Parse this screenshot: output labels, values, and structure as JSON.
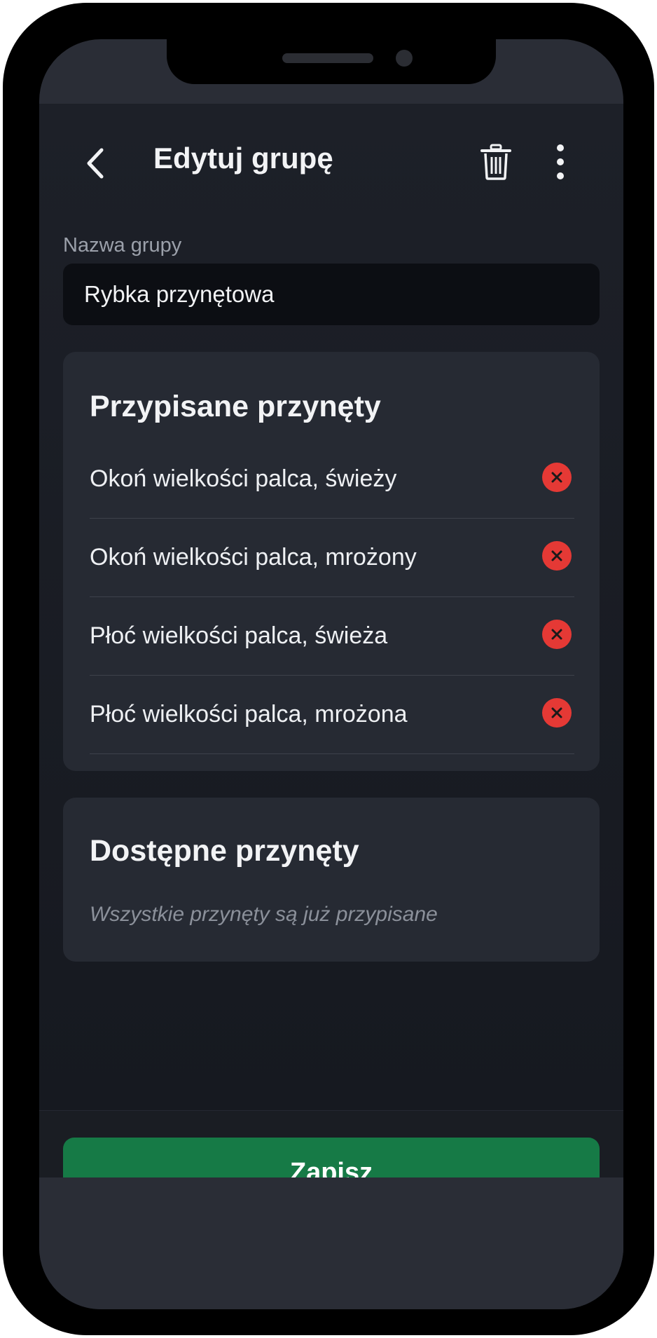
{
  "header": {
    "title": "Edytuj grupę",
    "back_icon": "chevron-left-icon",
    "delete_icon": "trash-icon",
    "more_icon": "more-vertical-icon"
  },
  "group_name": {
    "label": "Nazwa grupy",
    "value": "Rybka przynętowa"
  },
  "assigned": {
    "title": "Przypisane przynęty",
    "items": [
      {
        "label": "Okoń wielkości palca, świeży"
      },
      {
        "label": "Okoń wielkości palca, mrożony"
      },
      {
        "label": "Płoć wielkości palca, świeża"
      },
      {
        "label": "Płoć wielkości palca, mrożona"
      }
    ],
    "remove_icon": "remove-circle-icon"
  },
  "available": {
    "title": "Dostępne przynęty",
    "empty_text": "Wszystkie przynęty są już przypisane"
  },
  "footer": {
    "save_label": "Zapisz"
  },
  "colors": {
    "background": "#1d2028",
    "card": "#262a33",
    "input": "#0c0e13",
    "remove": "#e53935",
    "save": "#167a46"
  }
}
